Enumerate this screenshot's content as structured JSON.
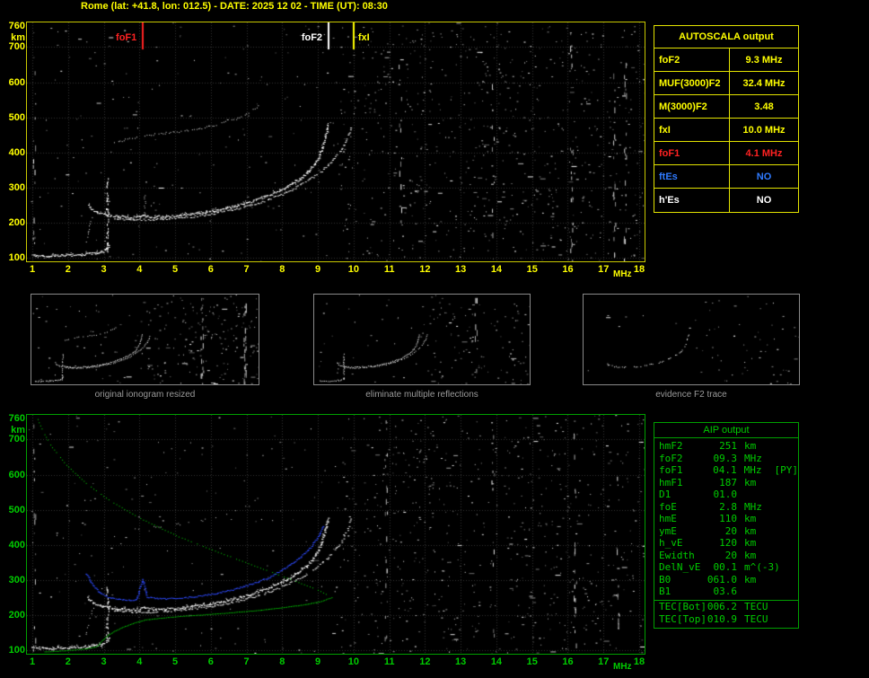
{
  "header": {
    "title": "Rome (lat: +41.8, lon: 012.5) - DATE: 2025 12 02 - TIME (UT): 08:30"
  },
  "autoscala_table": {
    "title": "AUTOSCALA output",
    "rows": [
      {
        "label": "foF2",
        "value": "9.3 MHz",
        "color": "#ffff00"
      },
      {
        "label": "MUF(3000)F2",
        "value": "32.4 MHz",
        "color": "#ffff00"
      },
      {
        "label": "M(3000)F2",
        "value": "3.48",
        "color": "#ffff00"
      },
      {
        "label": "fxI",
        "value": "10.0 MHz",
        "color": "#ffff00"
      },
      {
        "label": "foF1",
        "value": "4.1 MHz",
        "color": "#ff2222"
      },
      {
        "label": "ftEs",
        "value": "NO",
        "color": "#2f7bff"
      },
      {
        "label": "h'Es",
        "value": "NO",
        "color": "#ffffff"
      }
    ]
  },
  "aip_table": {
    "title": "AIP output",
    "rows": [
      {
        "name": "hmF2",
        "value": "251",
        "unit": "km",
        "extra": ""
      },
      {
        "name": "foF2",
        "value": "09.3",
        "unit": "MHz",
        "extra": ""
      },
      {
        "name": "foF1",
        "value": "04.1",
        "unit": "MHz",
        "extra": "[PY]"
      },
      {
        "name": "hmF1",
        "value": "187",
        "unit": "km",
        "extra": ""
      },
      {
        "name": "D1",
        "value": "01.0",
        "unit": "",
        "extra": ""
      },
      {
        "name": "foE",
        "value": "2.8",
        "unit": "MHz",
        "extra": ""
      },
      {
        "name": "hmE",
        "value": "110",
        "unit": "km",
        "extra": ""
      },
      {
        "name": "ymE",
        "value": "20",
        "unit": "km",
        "extra": ""
      },
      {
        "name": "h_vE",
        "value": "120",
        "unit": "km",
        "extra": ""
      },
      {
        "name": "Ewidth",
        "value": "20",
        "unit": "km",
        "extra": ""
      },
      {
        "name": "DelN_vE",
        "value": "00.1",
        "unit": "m^(-3)",
        "extra": ""
      },
      {
        "name": "B0",
        "value": "061.0",
        "unit": "km",
        "extra": ""
      },
      {
        "name": "B1",
        "value": "03.6",
        "unit": "",
        "extra": ""
      }
    ],
    "tec_rows": [
      {
        "name": "TEC[Bot]",
        "value": "006.2",
        "unit": "TECU"
      },
      {
        "name": "TEC[Top]",
        "value": "010.9",
        "unit": "TECU"
      }
    ]
  },
  "thumbnails": [
    {
      "caption": "original ionogram resized"
    },
    {
      "caption": "eliminate multiple reflections"
    },
    {
      "caption": "evidence F2 trace"
    }
  ],
  "chart_data": [
    {
      "id": "scaled-ionogram",
      "type": "scatter",
      "title": "AUTOSCALA scaled ionogram",
      "xlabel": "MHz",
      "ylabel": "km",
      "xlim": [
        1,
        18
      ],
      "ylim": [
        100,
        760
      ],
      "x_ticks": [
        1,
        2,
        3,
        4,
        5,
        6,
        7,
        8,
        9,
        10,
        11,
        12,
        13,
        14,
        15,
        16,
        17,
        18
      ],
      "y_ticks": [
        760,
        700,
        600,
        500,
        400,
        300,
        200,
        100
      ],
      "axis_color": "#ffff00",
      "grid": true,
      "markers": [
        {
          "label": "foF1",
          "x": 4.1,
          "color": "#ff2222",
          "side": "left"
        },
        {
          "label": "foF2",
          "x": 9.3,
          "color": "#ffffff",
          "side": "left"
        },
        {
          "label": "fxI",
          "x": 10.0,
          "color": "#ffff00",
          "side": "right"
        }
      ],
      "traces": [
        {
          "name": "F2-trace-O",
          "color": "#ffffff",
          "points": [
            [
              2.55,
              250
            ],
            [
              2.7,
              236
            ],
            [
              2.9,
              227
            ],
            [
              3.2,
              221
            ],
            [
              3.6,
              217
            ],
            [
              4.0,
              216
            ],
            [
              4.1,
              223
            ],
            [
              4.25,
              217
            ],
            [
              4.7,
              218
            ],
            [
              5.2,
              222
            ],
            [
              5.7,
              228
            ],
            [
              6.2,
              237
            ],
            [
              6.7,
              248
            ],
            [
              7.2,
              263
            ],
            [
              7.7,
              282
            ],
            [
              8.1,
              302
            ],
            [
              8.5,
              326
            ],
            [
              8.8,
              354
            ],
            [
              9.0,
              384
            ],
            [
              9.12,
              416
            ],
            [
              9.2,
              448
            ],
            [
              9.28,
              480
            ]
          ]
        },
        {
          "name": "F2-trace-X",
          "color": "#e8e8e8",
          "points": [
            [
              3.3,
              213
            ],
            [
              3.8,
              209
            ],
            [
              4.3,
              209
            ],
            [
              4.8,
              212
            ],
            [
              5.3,
              216
            ],
            [
              5.8,
              222
            ],
            [
              6.3,
              231
            ],
            [
              6.8,
              242
            ],
            [
              7.3,
              256
            ],
            [
              7.8,
              274
            ],
            [
              8.3,
              296
            ],
            [
              8.7,
              320
            ],
            [
              9.1,
              348
            ],
            [
              9.4,
              378
            ],
            [
              9.65,
              410
            ],
            [
              9.82,
              444
            ],
            [
              9.93,
              478
            ]
          ]
        },
        {
          "name": "E-F-cusp",
          "color": "#ffffff",
          "points": [
            [
              3.1,
              118
            ],
            [
              3.08,
              160
            ],
            [
              3.12,
              205
            ],
            [
              3.09,
              248
            ],
            [
              3.11,
              290
            ],
            [
              3.1,
              328
            ]
          ]
        },
        {
          "name": "Es-trace",
          "color": "#ffffff",
          "points": [
            [
              1.0,
              108
            ],
            [
              1.4,
              106
            ],
            [
              1.8,
              107
            ],
            [
              2.2,
              109
            ],
            [
              2.6,
              112
            ],
            [
              2.9,
              116
            ],
            [
              3.05,
              124
            ],
            [
              3.15,
              140
            ]
          ]
        },
        {
          "name": "E-cusp-tail",
          "color": "#dddddd",
          "points": [
            [
              2.5,
              140
            ],
            [
              2.55,
              172
            ],
            [
              2.62,
              202
            ],
            [
              2.72,
              224
            ]
          ]
        },
        {
          "name": "foF1-cusp",
          "color": "#cccccc",
          "points": [
            [
              4.13,
              220
            ],
            [
              4.15,
              252
            ],
            [
              4.14,
              282
            ]
          ]
        },
        {
          "name": "second-hop",
          "color": "#e0e0e0",
          "points": [
            [
              3.3,
              428
            ],
            [
              3.7,
              440
            ],
            [
              4.2,
              450
            ],
            [
              4.7,
              456
            ],
            [
              5.2,
              461
            ],
            [
              5.7,
              469
            ],
            [
              6.2,
              481
            ],
            [
              6.7,
              497
            ],
            [
              7.1,
              516
            ],
            [
              7.35,
              536
            ]
          ]
        }
      ]
    },
    {
      "id": "profile-ionogram",
      "type": "scatter",
      "title": "AIP restored trace and electron density profile",
      "xlabel": "MHz",
      "ylabel": "km",
      "xlim": [
        1,
        18
      ],
      "ylim": [
        100,
        760
      ],
      "x_ticks": [
        1,
        2,
        3,
        4,
        5,
        6,
        7,
        8,
        9,
        10,
        11,
        12,
        13,
        14,
        15,
        16,
        17,
        18
      ],
      "y_ticks": [
        760,
        700,
        600,
        500,
        400,
        300,
        200,
        100
      ],
      "axis_color": "#00cc00",
      "grid": true,
      "traces": [
        {
          "name": "F2-trace-O",
          "color": "#ffffff",
          "points": [
            [
              2.55,
              250
            ],
            [
              2.7,
              236
            ],
            [
              2.9,
              227
            ],
            [
              3.2,
              221
            ],
            [
              3.6,
              217
            ],
            [
              4.0,
              216
            ],
            [
              4.1,
              223
            ],
            [
              4.25,
              217
            ],
            [
              4.7,
              218
            ],
            [
              5.2,
              222
            ],
            [
              5.7,
              228
            ],
            [
              6.2,
              237
            ],
            [
              6.7,
              248
            ],
            [
              7.2,
              263
            ],
            [
              7.7,
              282
            ],
            [
              8.1,
              302
            ],
            [
              8.5,
              326
            ],
            [
              8.8,
              354
            ],
            [
              9.0,
              384
            ],
            [
              9.12,
              416
            ],
            [
              9.2,
              448
            ],
            [
              9.28,
              480
            ]
          ]
        },
        {
          "name": "F2-trace-X",
          "color": "#e8e8e8",
          "points": [
            [
              3.3,
              213
            ],
            [
              3.8,
              209
            ],
            [
              4.3,
              209
            ],
            [
              4.8,
              212
            ],
            [
              5.3,
              216
            ],
            [
              5.8,
              222
            ],
            [
              6.3,
              231
            ],
            [
              6.8,
              242
            ],
            [
              7.3,
              256
            ],
            [
              7.8,
              274
            ],
            [
              8.3,
              296
            ],
            [
              8.7,
              320
            ],
            [
              9.1,
              348
            ],
            [
              9.4,
              378
            ],
            [
              9.65,
              410
            ],
            [
              9.82,
              444
            ],
            [
              9.93,
              478
            ]
          ]
        },
        {
          "name": "E-F-cusp",
          "color": "#ffffff",
          "points": [
            [
              3.1,
              125
            ],
            [
              3.08,
              170
            ],
            [
              3.12,
              215
            ],
            [
              3.09,
              255
            ],
            [
              3.11,
              285
            ]
          ]
        },
        {
          "name": "Es-trace",
          "color": "#ffffff",
          "points": [
            [
              1.0,
              108
            ],
            [
              1.4,
              106
            ],
            [
              1.8,
              107
            ],
            [
              2.2,
              109
            ],
            [
              2.6,
              112
            ],
            [
              2.9,
              116
            ],
            [
              3.05,
              124
            ],
            [
              3.15,
              140
            ]
          ]
        },
        {
          "name": "E-cusp-tail",
          "color": "#dddddd",
          "points": [
            [
              2.5,
              140
            ],
            [
              2.55,
              172
            ],
            [
              2.62,
              202
            ],
            [
              2.72,
              224
            ]
          ]
        },
        {
          "name": "second-hop-remnant",
          "color": "#bbbbbb",
          "points": [
            [
              3.3,
              428
            ],
            [
              3.7,
              440
            ],
            [
              4.2,
              450
            ],
            [
              4.7,
              456
            ],
            [
              5.2,
              461
            ],
            [
              5.7,
              469
            ],
            [
              6.2,
              481
            ],
            [
              6.7,
              497
            ],
            [
              7.1,
              516
            ],
            [
              7.35,
              536
            ]
          ]
        },
        {
          "name": "restored-trace",
          "color": "#2e4bff",
          "points": [
            [
              2.5,
              318
            ],
            [
              2.65,
              290
            ],
            [
              2.85,
              266
            ],
            [
              3.1,
              252
            ],
            [
              3.5,
              244
            ],
            [
              3.9,
              244
            ],
            [
              4.08,
              302
            ],
            [
              4.2,
              252
            ],
            [
              4.6,
              247
            ],
            [
              5.1,
              249
            ],
            [
              5.6,
              254
            ],
            [
              6.1,
              262
            ],
            [
              6.6,
              273
            ],
            [
              7.1,
              288
            ],
            [
              7.6,
              307
            ],
            [
              8.0,
              330
            ],
            [
              8.4,
              357
            ],
            [
              8.75,
              390
            ],
            [
              9.0,
              424
            ],
            [
              9.15,
              458
            ]
          ]
        },
        {
          "name": "profile-topside",
          "color": "#00dd00",
          "points": [
            [
              1.15,
              758
            ],
            [
              1.3,
              722
            ],
            [
              1.55,
              678
            ],
            [
              1.95,
              628
            ],
            [
              2.5,
              576
            ],
            [
              3.2,
              524
            ],
            [
              4.1,
              472
            ],
            [
              5.1,
              424
            ],
            [
              6.2,
              380
            ],
            [
              7.3,
              338
            ],
            [
              8.3,
              300
            ],
            [
              9.0,
              272
            ],
            [
              9.3,
              256
            ],
            [
              9.38,
              251
            ]
          ]
        },
        {
          "name": "profile-bottomside",
          "color": "#00dd00",
          "points": [
            [
              9.38,
              251
            ],
            [
              9.1,
              240
            ],
            [
              8.6,
              230
            ],
            [
              8.0,
              222
            ],
            [
              7.3,
              214
            ],
            [
              6.5,
              207
            ],
            [
              5.7,
              201
            ],
            [
              5.0,
              196
            ],
            [
              4.5,
              191
            ],
            [
              4.15,
              187
            ],
            [
              3.85,
              178
            ],
            [
              3.55,
              167
            ],
            [
              3.3,
              155
            ],
            [
              3.1,
              142
            ],
            [
              2.95,
              128
            ],
            [
              2.85,
              115
            ],
            [
              2.78,
              110
            ],
            [
              2.5,
              105
            ],
            [
              2.1,
              101
            ],
            [
              1.7,
              98
            ],
            [
              1.3,
              96
            ]
          ]
        }
      ]
    }
  ]
}
